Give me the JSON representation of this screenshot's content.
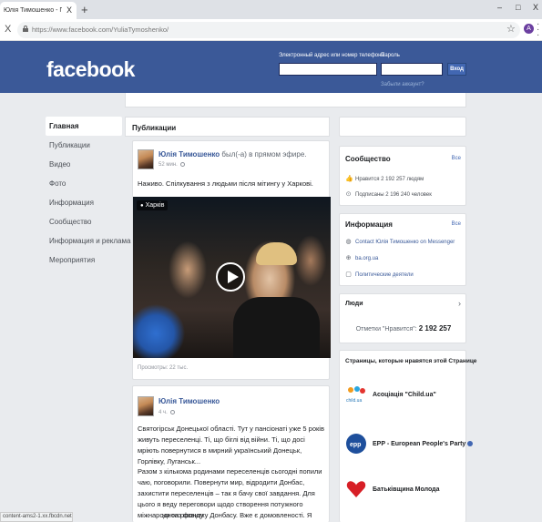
{
  "browser": {
    "tab_title": "Юлія Тимошенко - Главная | Fa",
    "tab_close": "X",
    "new_tab": "+",
    "win_min": "–",
    "win_max": "□",
    "win_close": "X",
    "back": "X",
    "url": "https://www.facebook.com/YuliaTymoshenko/",
    "profile_initial": "A",
    "status_url": "content-ams2-1.xx.fbcdn.net..."
  },
  "header": {
    "logo": "facebook",
    "email_label": "Электронный адрес или номер телефона",
    "password_label": "Пароль",
    "login_button": "Вход",
    "forgot_link": "Забыли аккаунт?"
  },
  "leftnav": {
    "items": [
      {
        "label": "Главная"
      },
      {
        "label": "Публикации"
      },
      {
        "label": "Видео"
      },
      {
        "label": "Фото"
      },
      {
        "label": "Информация"
      },
      {
        "label": "Сообщество"
      },
      {
        "label": "Информация и реклама"
      },
      {
        "label": "Мероприятия"
      }
    ]
  },
  "main": {
    "section_title": "Публикации",
    "post1": {
      "author": "Юлія Тимошенко",
      "action": "был(-а) в прямом эфире.",
      "time": "52 мин.",
      "text": "Наживо. Спілкування з людьми після мітингу у Харкові.",
      "location": "Харків",
      "views": "Просмотры: 22 тыс."
    },
    "post2": {
      "author": "Юлія Тимошенко",
      "time": "4 ч.",
      "para1": "Святогірськ Донецької області. Тут у пансіонаті уже 5 років живуть переселенці. Ті, що біглі від війни. Ті, що досі мріють повернутися в мирний український Донецьк, Горлівку, Луганськ...",
      "para2": "Разом з кількома родинами переселенців сьогодні попили чаю, поговорили. Повернути мир, відродити Донбас, захистити переселенців – так я бачу свої завдання. Для цього я веду переговори щодо створення потужного міжнародного фонду",
      "para3": "ня та розвитку Донбасу. Вже є домовленості. Я знаю"
    }
  },
  "right": {
    "community": {
      "title": "Сообщество",
      "all": "Все",
      "likes": "Нравится 2 192 257 людям",
      "followers": "Подписаны 2 196 240 человек"
    },
    "info": {
      "title": "Информация",
      "all": "Все",
      "messenger": "Contact Юлія Тимошенко on Messenger",
      "website": "ba.org.ua",
      "category": "Политические деятели"
    },
    "people": {
      "title": "Люди",
      "chevron": "›",
      "likes_label": "Отметки \"Нравится\":",
      "likes_count": "2 192 257"
    },
    "pages": {
      "title": "Страницы, которые нравятся этой Странице",
      "items": [
        {
          "name": "Асоціація \"Child.ua\""
        },
        {
          "name": "EPP - European People's Party"
        },
        {
          "name": "Батьківщина Молода"
        }
      ],
      "epp_logo": "epp",
      "child_logo": "child.ua"
    }
  }
}
